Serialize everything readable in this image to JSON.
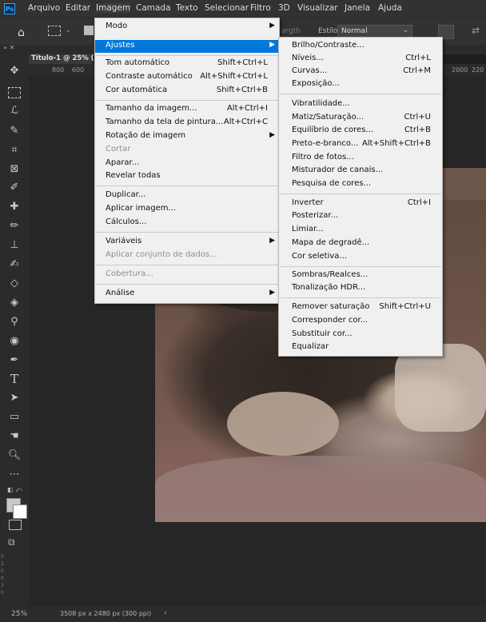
{
  "menubar": {
    "logo": "Ps",
    "items": [
      "Arquivo",
      "Editar",
      "Imagem",
      "Camada",
      "Texto",
      "Selecionar",
      "Filtro",
      "3D",
      "Visualizar",
      "Janela",
      "Ajuda"
    ]
  },
  "options_bar": {
    "style_label": "Estilo:",
    "style_value": "Normal",
    "width_partial": "argth"
  },
  "document_tab": "Título-1 @ 25% (",
  "ruler": [
    "800",
    "600",
    "2000",
    "220"
  ],
  "imagem_menu": [
    {
      "label": "Modo",
      "submenu": true
    },
    {
      "label": "Ajustes",
      "submenu": true,
      "highlighted": true
    },
    {
      "label": "Tom automático",
      "shortcut": "Shift+Ctrl+L"
    },
    {
      "label": "Contraste automático",
      "shortcut": "Alt+Shift+Ctrl+L"
    },
    {
      "label": "Cor automática",
      "shortcut": "Shift+Ctrl+B"
    },
    {
      "label": "Tamanho da imagem...",
      "shortcut": "Alt+Ctrl+I"
    },
    {
      "label": "Tamanho da tela de pintura...",
      "shortcut": "Alt+Ctrl+C"
    },
    {
      "label": "Rotação de imagem",
      "submenu": true
    },
    {
      "label": "Cortar",
      "disabled": true
    },
    {
      "label": "Aparar..."
    },
    {
      "label": "Revelar todas"
    },
    {
      "label": "Duplicar..."
    },
    {
      "label": "Aplicar imagem..."
    },
    {
      "label": "Cálculos..."
    },
    {
      "label": "Variáveis",
      "submenu": true
    },
    {
      "label": "Aplicar conjunto de dados...",
      "disabled": true
    },
    {
      "label": "Cobertura...",
      "disabled": true
    },
    {
      "label": "Análise",
      "submenu": true
    }
  ],
  "ajustes_menu": [
    {
      "label": "Brilho/Contraste..."
    },
    {
      "label": "Níveis...",
      "shortcut": "Ctrl+L"
    },
    {
      "label": "Curvas...",
      "shortcut": "Ctrl+M"
    },
    {
      "label": "Exposição..."
    },
    {
      "label": "Vibratilidade..."
    },
    {
      "label": "Matiz/Saturação...",
      "shortcut": "Ctrl+U"
    },
    {
      "label": "Equilíbrio de cores...",
      "shortcut": "Ctrl+B"
    },
    {
      "label": "Preto-e-branco...",
      "shortcut": "Alt+Shift+Ctrl+B"
    },
    {
      "label": "Filtro de fotos..."
    },
    {
      "label": "Misturador de canais..."
    },
    {
      "label": "Pesquisa de cores..."
    },
    {
      "label": "Inverter",
      "shortcut": "Ctrl+I"
    },
    {
      "label": "Posterizar..."
    },
    {
      "label": "Limiar..."
    },
    {
      "label": "Mapa de degradê..."
    },
    {
      "label": "Cor seletiva..."
    },
    {
      "label": "Sombras/Realces..."
    },
    {
      "label": "Tonalização HDR..."
    },
    {
      "label": "Remover saturação",
      "shortcut": "Shift+Ctrl+U"
    },
    {
      "label": "Corresponder cor..."
    },
    {
      "label": "Substituir cor..."
    },
    {
      "label": "Equalizar"
    }
  ],
  "status": {
    "zoom": "25%",
    "doc_info": "3508 px x 2480 px (300 ppi)",
    "arrow": "›"
  },
  "vertical_ruler": "0 2 0 0 3 0",
  "colors": {
    "ui_dark": "#323232",
    "panel": "#2b2b2b",
    "menu_bg": "#f0f0f0",
    "highlight": "#0078d7",
    "ps_blue": "#31a8ff"
  }
}
